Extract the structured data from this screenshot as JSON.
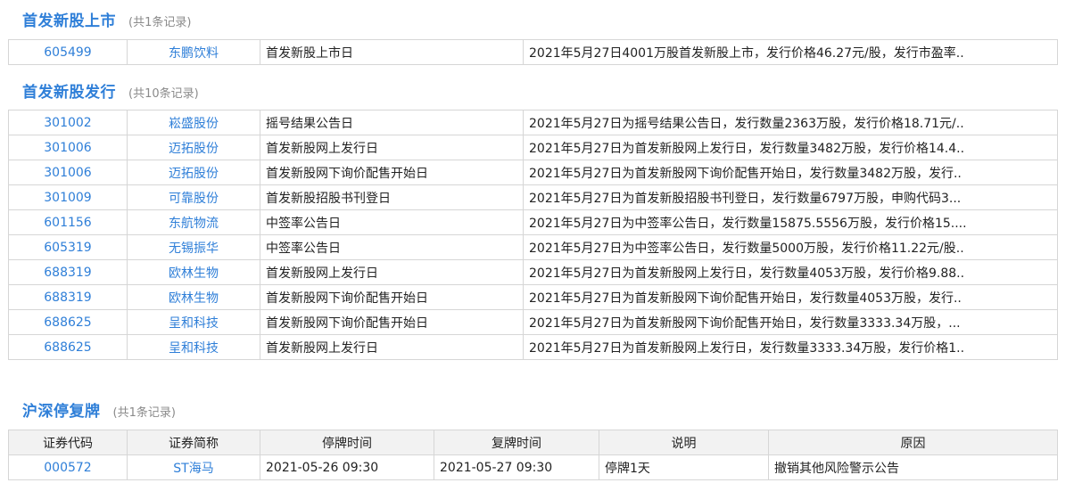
{
  "ipo_listing": {
    "title": "首发新股上市",
    "count": "(共1条记录)",
    "rows": [
      {
        "code": "605499",
        "name": "东鹏饮料",
        "event": "首发新股上市日",
        "desc": "2021年5月27日4001万股首发新股上市，发行价格46.27元/股，发行市盈率.."
      }
    ]
  },
  "ipo_issue": {
    "title": "首发新股发行",
    "count": "(共10条记录)",
    "rows": [
      {
        "code": "301002",
        "name": "崧盛股份",
        "event": "摇号结果公告日",
        "desc": "2021年5月27日为摇号结果公告日，发行数量2363万股，发行价格18.71元/.."
      },
      {
        "code": "301006",
        "name": "迈拓股份",
        "event": "首发新股网上发行日",
        "desc": "2021年5月27日为首发新股网上发行日，发行数量3482万股，发行价格14.4.."
      },
      {
        "code": "301006",
        "name": "迈拓股份",
        "event": "首发新股网下询价配售开始日",
        "desc": "2021年5月27日为首发新股网下询价配售开始日，发行数量3482万股，发行.."
      },
      {
        "code": "301009",
        "name": "可靠股份",
        "event": "首发新股招股书刊登日",
        "desc": "2021年5月27日为首发新股招股书刊登日，发行数量6797万股，申购代码3..."
      },
      {
        "code": "601156",
        "name": "东航物流",
        "event": "中签率公告日",
        "desc": "2021年5月27日为中签率公告日，发行数量15875.5556万股，发行价格15...."
      },
      {
        "code": "605319",
        "name": "无锡振华",
        "event": "中签率公告日",
        "desc": "2021年5月27日为中签率公告日，发行数量5000万股，发行价格11.22元/股.."
      },
      {
        "code": "688319",
        "name": "欧林生物",
        "event": "首发新股网上发行日",
        "desc": "2021年5月27日为首发新股网上发行日，发行数量4053万股，发行价格9.88.."
      },
      {
        "code": "688319",
        "name": "欧林生物",
        "event": "首发新股网下询价配售开始日",
        "desc": "2021年5月27日为首发新股网下询价配售开始日，发行数量4053万股，发行.."
      },
      {
        "code": "688625",
        "name": "呈和科技",
        "event": "首发新股网下询价配售开始日",
        "desc": "2021年5月27日为首发新股网下询价配售开始日，发行数量3333.34万股，..."
      },
      {
        "code": "688625",
        "name": "呈和科技",
        "event": "首发新股网上发行日",
        "desc": "2021年5月27日为首发新股网上发行日，发行数量3333.34万股，发行价格1.."
      }
    ]
  },
  "suspension": {
    "title": "沪深停复牌",
    "count": "(共1条记录)",
    "headers": [
      "证券代码",
      "证券简称",
      "停牌时间",
      "复牌时间",
      "说明",
      "原因"
    ],
    "rows": [
      {
        "code": "000572",
        "name": "ST海马",
        "suspend_time": "2021-05-26 09:30",
        "resume_time": "2021-05-27 09:30",
        "note": "停牌1天",
        "reason": "撤销其他风险警示公告"
      }
    ]
  },
  "colors": {
    "accent": "#2f7fd8",
    "muted": "#8a8a8a",
    "border": "#d6d6d6",
    "header_bg": "#f2f2f2"
  }
}
